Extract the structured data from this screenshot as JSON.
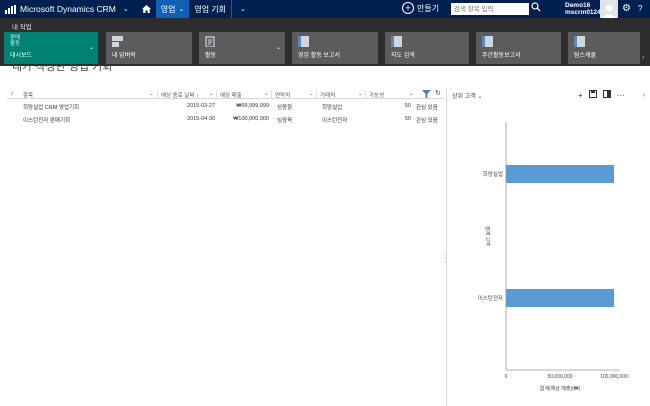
{
  "topbar": {
    "brand": "Microsoft Dynamics CRM",
    "tabs": [
      {
        "label": "영업",
        "active": true
      },
      {
        "label": "영업 기회",
        "active": false
      }
    ],
    "new_label": "만들기",
    "search_placeholder": "검색 항목 입력",
    "user_line1": "Demo16",
    "user_line2": "mscrm0124"
  },
  "band": {
    "title": "내 작업",
    "tiles": [
      {
        "label": "대시보드",
        "top": "판매\n활동",
        "icon": "dashboard-icon",
        "primary": true
      },
      {
        "label": "내 담벼락",
        "icon": "wall-icon"
      },
      {
        "label": "활동",
        "icon": "activity-icon"
      },
      {
        "label": "영업 활동 보고서",
        "icon": "report-icon"
      },
      {
        "label": "지도 검색",
        "icon": "report-icon"
      },
      {
        "label": "주간활동보고서",
        "icon": "report-icon"
      },
      {
        "label": "팀스케줄",
        "icon": "report-icon"
      }
    ]
  },
  "view": {
    "title": "내가 작성한 영업 기회"
  },
  "grid": {
    "columns": [
      "항목",
      "예상 종료 날짜",
      "예상 매출",
      "연락처",
      "거래처",
      "가능성"
    ],
    "rows": [
      {
        "topic": "희망실업 CRM 영업기회",
        "close": "2015-03-27",
        "revenue": "₩99,999,999",
        "contact": "성종항",
        "account": "희망실업",
        "prob": "50",
        "status": "관심 있음"
      },
      {
        "topic": "이스턴전자 판매기회",
        "close": "2015-04-30",
        "revenue": "₩100,000,000",
        "contact": "임광욱",
        "account": "이스턴전자",
        "prob": "50",
        "status": "관심 있음"
      }
    ]
  },
  "chart_pane": {
    "selector": "상위 고객"
  },
  "chart_data": {
    "type": "bar",
    "orientation": "horizontal",
    "categories": [
      "희망실업",
      "이스턴전자"
    ],
    "values": [
      99999999,
      100000000
    ],
    "xlim": [
      0,
      100000000
    ],
    "xticks": [
      "0",
      "50,000,000",
      "100,000,000"
    ],
    "xlabel": "합계(예상 매출)(₩)",
    "ylabel": "잠재 고객",
    "bar_color": "#5b9bd5"
  }
}
